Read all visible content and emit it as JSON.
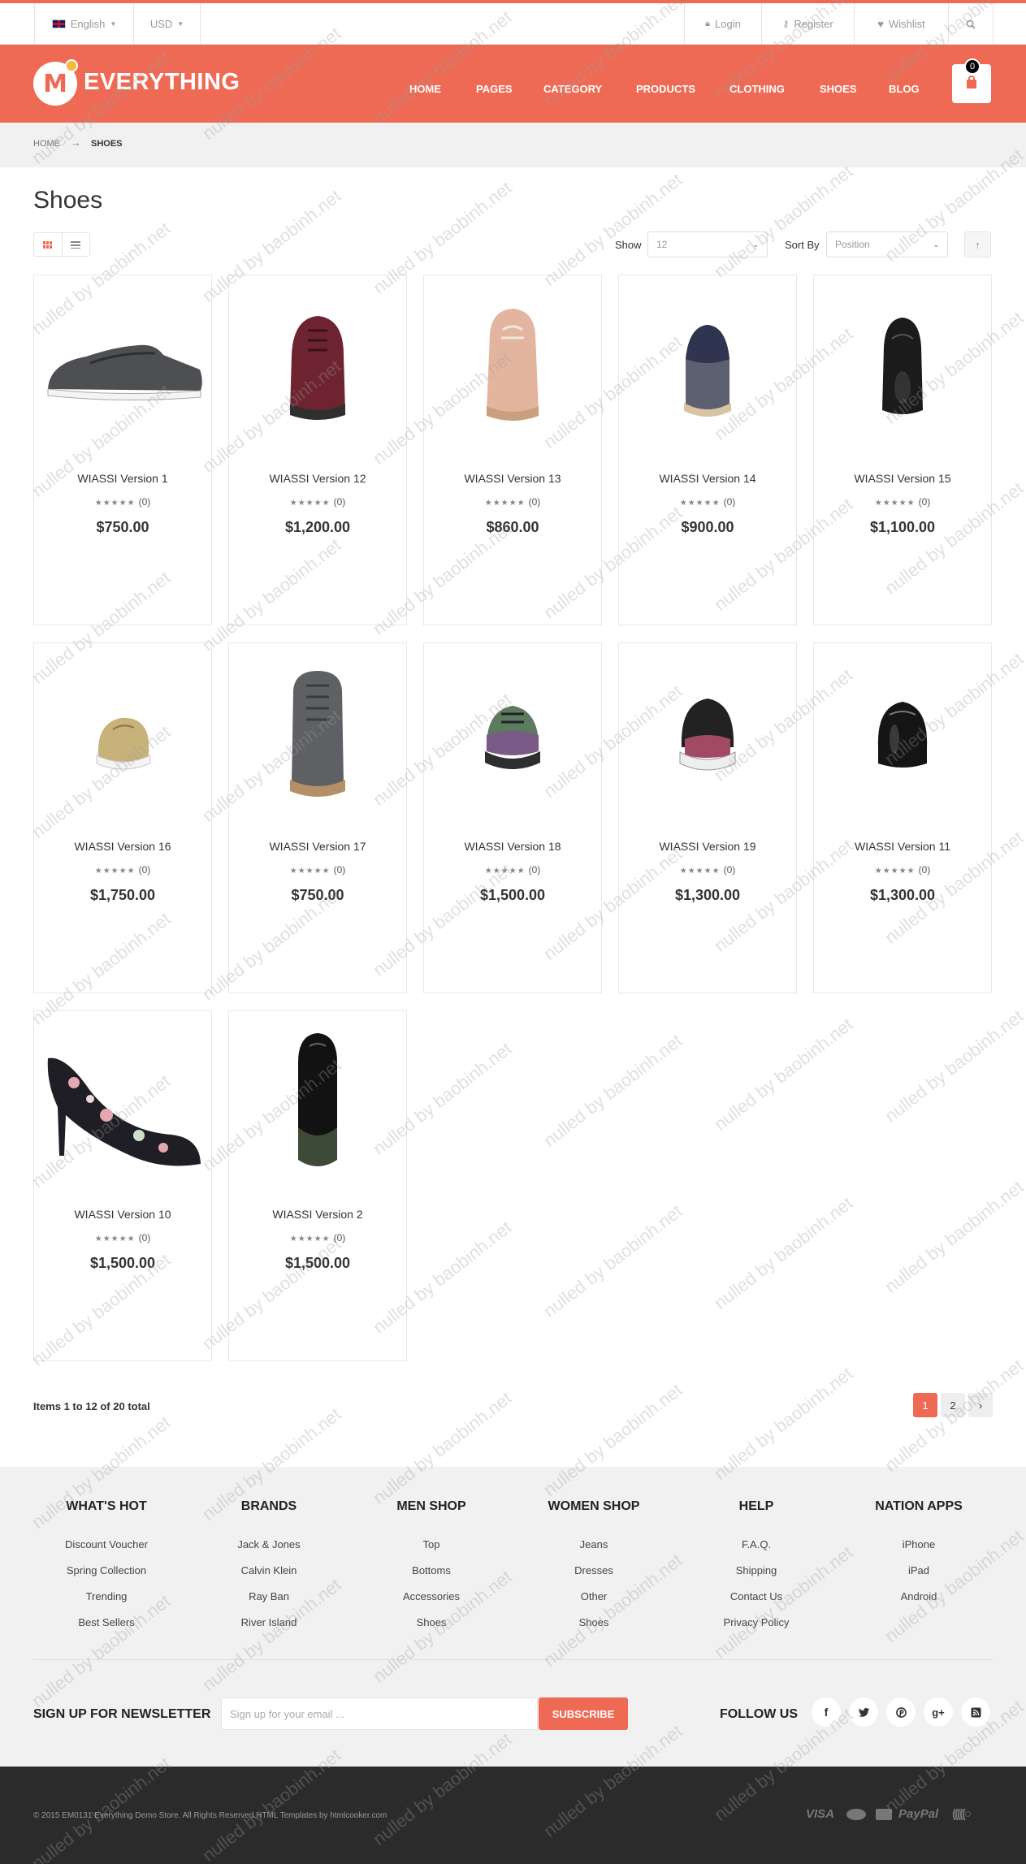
{
  "topbar": {
    "language": "English",
    "currency": "USD",
    "login": "Login",
    "register": "Register",
    "wishlist": "Wishlist"
  },
  "header": {
    "logo_text": "EVERYTHING",
    "logo_letter": "M",
    "nav": [
      "HOME",
      "PAGES",
      "CATEGORY",
      "PRODUCTS",
      "CLOTHING",
      "SHOES",
      "BLOG"
    ],
    "cart_count": "0",
    "accent_color": "#ee6a54"
  },
  "breadcrumb": {
    "home": "HOME",
    "arrow": "→",
    "current": "SHOES"
  },
  "page_title": "Shoes",
  "toolbar": {
    "show_label": "Show",
    "show_value": "12",
    "sort_label": "Sort By",
    "sort_value": "Position"
  },
  "products": [
    {
      "name": "WIASSI Version 1",
      "reviews": "(0)",
      "price": "$750.00",
      "stars": "★★★★★"
    },
    {
      "name": "WIASSI Version 12",
      "reviews": "(0)",
      "price": "$1,200.00",
      "stars": "★★★★★"
    },
    {
      "name": "WIASSI Version 13",
      "reviews": "(0)",
      "price": "$860.00",
      "stars": "★★★★★"
    },
    {
      "name": "WIASSI Version 14",
      "reviews": "(0)",
      "price": "$900.00",
      "stars": "★★★★★"
    },
    {
      "name": "WIASSI Version 15",
      "reviews": "(0)",
      "price": "$1,100.00",
      "stars": "★★★★★"
    },
    {
      "name": "WIASSI Version 16",
      "reviews": "(0)",
      "price": "$1,750.00",
      "stars": "★★★★★"
    },
    {
      "name": "WIASSI Version 17",
      "reviews": "(0)",
      "price": "$750.00",
      "stars": "★★★★★"
    },
    {
      "name": "WIASSI Version 18",
      "reviews": "(0)",
      "price": "$1,500.00",
      "stars": "★★★★★"
    },
    {
      "name": "WIASSI Version 19",
      "reviews": "(0)",
      "price": "$1,300.00",
      "stars": "★★★★★"
    },
    {
      "name": "WIASSI Version 11",
      "reviews": "(0)",
      "price": "$1,300.00",
      "stars": "★★★★★"
    },
    {
      "name": "WIASSI Version 10",
      "reviews": "(0)",
      "price": "$1,500.00",
      "stars": "★★★★★"
    },
    {
      "name": "WIASSI Version 2",
      "reviews": "(0)",
      "price": "$1,500.00",
      "stars": "★★★★★"
    }
  ],
  "pager": {
    "summary": "Items 1 to 12 of 20 total",
    "pages": [
      "1",
      "2"
    ],
    "next": "›"
  },
  "footer": {
    "columns": [
      {
        "title": "WHAT'S HOT",
        "links": [
          "Discount Voucher",
          "Spring Collection",
          "Trending",
          "Best Sellers"
        ]
      },
      {
        "title": "BRANDS",
        "links": [
          "Jack & Jones",
          "Calvin Klein",
          "Ray Ban",
          "River Island"
        ]
      },
      {
        "title": "MEN SHOP",
        "links": [
          "Top",
          "Bottoms",
          "Accessories",
          "Shoes"
        ]
      },
      {
        "title": "WOMEN SHOP",
        "links": [
          "Jeans",
          "Dresses",
          "Other",
          "Shoes"
        ]
      },
      {
        "title": "HELP",
        "links": [
          "F.A.Q.",
          "Shipping",
          "Contact Us",
          "Privacy Policy"
        ]
      },
      {
        "title": "NATION APPS",
        "links": [
          "iPhone",
          "iPad",
          "Android"
        ]
      }
    ],
    "newsletter_label": "SIGN UP FOR NEWSLETTER",
    "newsletter_placeholder": "Sign up for your email ...",
    "subscribe": "SUBSCRIBE",
    "follow_label": "FOLLOW US",
    "social": [
      "f",
      "t",
      "p",
      "g+",
      "rss"
    ]
  },
  "bottom": {
    "copyright": "© 2015 EM0131 Everything Demo Store. All Rights Reserved.HTML Templates by htmlcooker.com",
    "payments": [
      "VISA",
      "PayPal"
    ]
  },
  "watermark": "nulled by baobinh.net"
}
